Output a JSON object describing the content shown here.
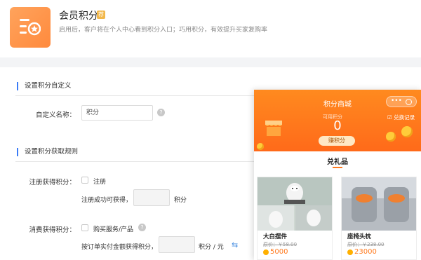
{
  "header": {
    "title": "会员积分",
    "badge": "荐",
    "description": "启用后，客户将在个人中心看到积分入口；巧用积分，有效提升买家复购率"
  },
  "section_custom": {
    "title": "设置积分自定义",
    "name_label": "自定义名称：",
    "name_value": "积分",
    "help": "?"
  },
  "section_rules": {
    "title": "设置积分获取规则",
    "register": {
      "label": "注册获得积分：",
      "checkbox_label": "注册",
      "success_text": "注册成功可获得，",
      "unit": "积分"
    },
    "consume": {
      "label": "消费获得积分：",
      "checkbox_label": "购买服务/产品",
      "help": "?",
      "order_text": "按订单实付金额获得积分，",
      "unit": "积分 / 元"
    }
  },
  "phone": {
    "title": "积分商城",
    "capsule_dots": "•••",
    "available_label": "可用积分",
    "available_value": "0",
    "earn_button": "赚积分",
    "history_link": "兑换记录",
    "gifts_title": "兑礼品",
    "products": [
      {
        "name": "大白摆件",
        "original_price": "原价：￥58.00",
        "points": "5000"
      },
      {
        "name": "座椅头枕",
        "original_price": "原价：￥238.00",
        "points": "23000"
      }
    ]
  },
  "colors": {
    "accent": "#ff7a1f",
    "section_marker": "#3b7cf6",
    "logo": "#ff8a3d"
  },
  "icons": {
    "logo": "list-star-icon",
    "help": "question-circle-icon",
    "swap": "swap-icon",
    "history": "checklist-icon"
  }
}
